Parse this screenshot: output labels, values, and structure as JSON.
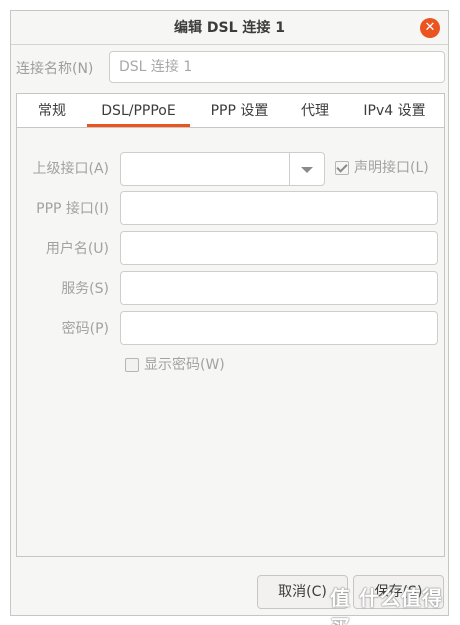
{
  "window": {
    "title": "编辑 DSL 连接 1"
  },
  "connection": {
    "label": "连接名称(N)",
    "value": "DSL 连接 1"
  },
  "tabs": [
    {
      "label": "常规"
    },
    {
      "label": "DSL/PPPoE"
    },
    {
      "label": "PPP 设置"
    },
    {
      "label": "代理"
    },
    {
      "label": "IPv4 设置"
    }
  ],
  "form": {
    "parent_interface_label": "上级接口(A)",
    "parent_interface_value": "",
    "claim_interface_label": "声明接口(L)",
    "ppp_interface_label": "PPP 接口(I)",
    "ppp_interface_value": "",
    "username_label": "用户名(U)",
    "username_value": "",
    "service_label": "服务(S)",
    "service_value": "",
    "password_label": "密码(P)",
    "password_value": "",
    "show_password_label": "显示密码(W)"
  },
  "buttons": {
    "cancel": "取消(C)",
    "save": "保存(S)"
  },
  "watermark": "值 什么值得买",
  "colors": {
    "accent": "#e95420",
    "close": "#e95420"
  },
  "icons": {
    "close": "close-icon",
    "dropdown": "chevron-down-icon",
    "check": "check-icon"
  }
}
